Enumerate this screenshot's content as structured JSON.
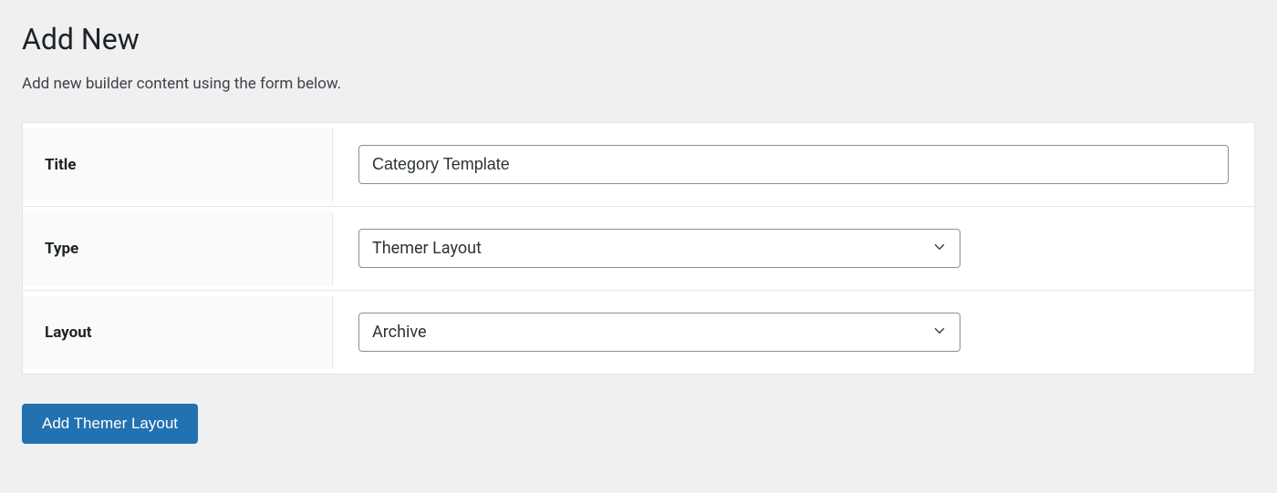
{
  "page": {
    "title": "Add New",
    "description": "Add new builder content using the form below."
  },
  "form": {
    "title": {
      "label": "Title",
      "value": "Category Template"
    },
    "type": {
      "label": "Type",
      "selected": "Themer Layout"
    },
    "layout": {
      "label": "Layout",
      "selected": "Archive"
    }
  },
  "button": {
    "submit": "Add Themer Layout"
  }
}
